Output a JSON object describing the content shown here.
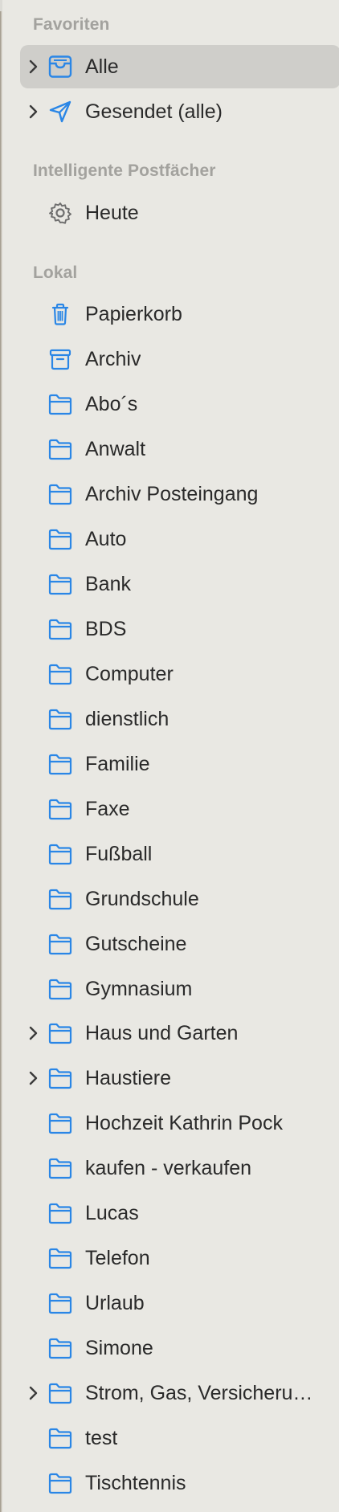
{
  "sections": {
    "favorites": {
      "header": "Favoriten",
      "items": [
        {
          "label": "Alle",
          "icon": "inbox-tray-icon",
          "expandable": true,
          "selected": true
        },
        {
          "label": "Gesendet (alle)",
          "icon": "paper-plane-icon",
          "expandable": true,
          "selected": false
        }
      ]
    },
    "smart": {
      "header": "Intelligente Postfächer",
      "items": [
        {
          "label": "Heute",
          "icon": "gear-icon",
          "expandable": false
        }
      ]
    },
    "local": {
      "header": "Lokal",
      "items": [
        {
          "label": "Papierkorb",
          "icon": "trash-icon",
          "expandable": false
        },
        {
          "label": "Archiv",
          "icon": "archive-box-icon",
          "expandable": false
        },
        {
          "label": "Abo´s",
          "icon": "folder-icon",
          "expandable": false
        },
        {
          "label": "Anwalt",
          "icon": "folder-icon",
          "expandable": false
        },
        {
          "label": "Archiv Posteingang",
          "icon": "folder-icon",
          "expandable": false
        },
        {
          "label": "Auto",
          "icon": "folder-icon",
          "expandable": false
        },
        {
          "label": "Bank",
          "icon": "folder-icon",
          "expandable": false
        },
        {
          "label": "BDS",
          "icon": "folder-icon",
          "expandable": false
        },
        {
          "label": "Computer",
          "icon": "folder-icon",
          "expandable": false
        },
        {
          "label": "dienstlich",
          "icon": "folder-icon",
          "expandable": false
        },
        {
          "label": "Familie",
          "icon": "folder-icon",
          "expandable": false
        },
        {
          "label": "Faxe",
          "icon": "folder-icon",
          "expandable": false
        },
        {
          "label": "Fußball",
          "icon": "folder-icon",
          "expandable": false
        },
        {
          "label": "Grundschule",
          "icon": "folder-icon",
          "expandable": false
        },
        {
          "label": "Gutscheine",
          "icon": "folder-icon",
          "expandable": false
        },
        {
          "label": "Gymnasium",
          "icon": "folder-icon",
          "expandable": false
        },
        {
          "label": "Haus und Garten",
          "icon": "folder-icon",
          "expandable": true
        },
        {
          "label": "Haustiere",
          "icon": "folder-icon",
          "expandable": true
        },
        {
          "label": "Hochzeit Kathrin Pock",
          "icon": "folder-icon",
          "expandable": false
        },
        {
          "label": "kaufen - verkaufen",
          "icon": "folder-icon",
          "expandable": false
        },
        {
          "label": "Lucas",
          "icon": "folder-icon",
          "expandable": false
        },
        {
          "label": "Telefon",
          "icon": "folder-icon",
          "expandable": false
        },
        {
          "label": "Urlaub",
          "icon": "folder-icon",
          "expandable": false
        },
        {
          "label": "Simone",
          "icon": "folder-icon",
          "expandable": false
        },
        {
          "label": "Strom, Gas, Versicheru…",
          "icon": "folder-icon",
          "expandable": true
        },
        {
          "label": "test",
          "icon": "folder-icon",
          "expandable": false
        },
        {
          "label": "Tischtennis",
          "icon": "folder-icon",
          "expandable": false
        }
      ]
    }
  },
  "colors": {
    "accent": "#2a86e6",
    "gear": "#6e6e6e",
    "header": "#a3a29e",
    "text": "#2a2a2a",
    "selection": "#cfceca"
  }
}
